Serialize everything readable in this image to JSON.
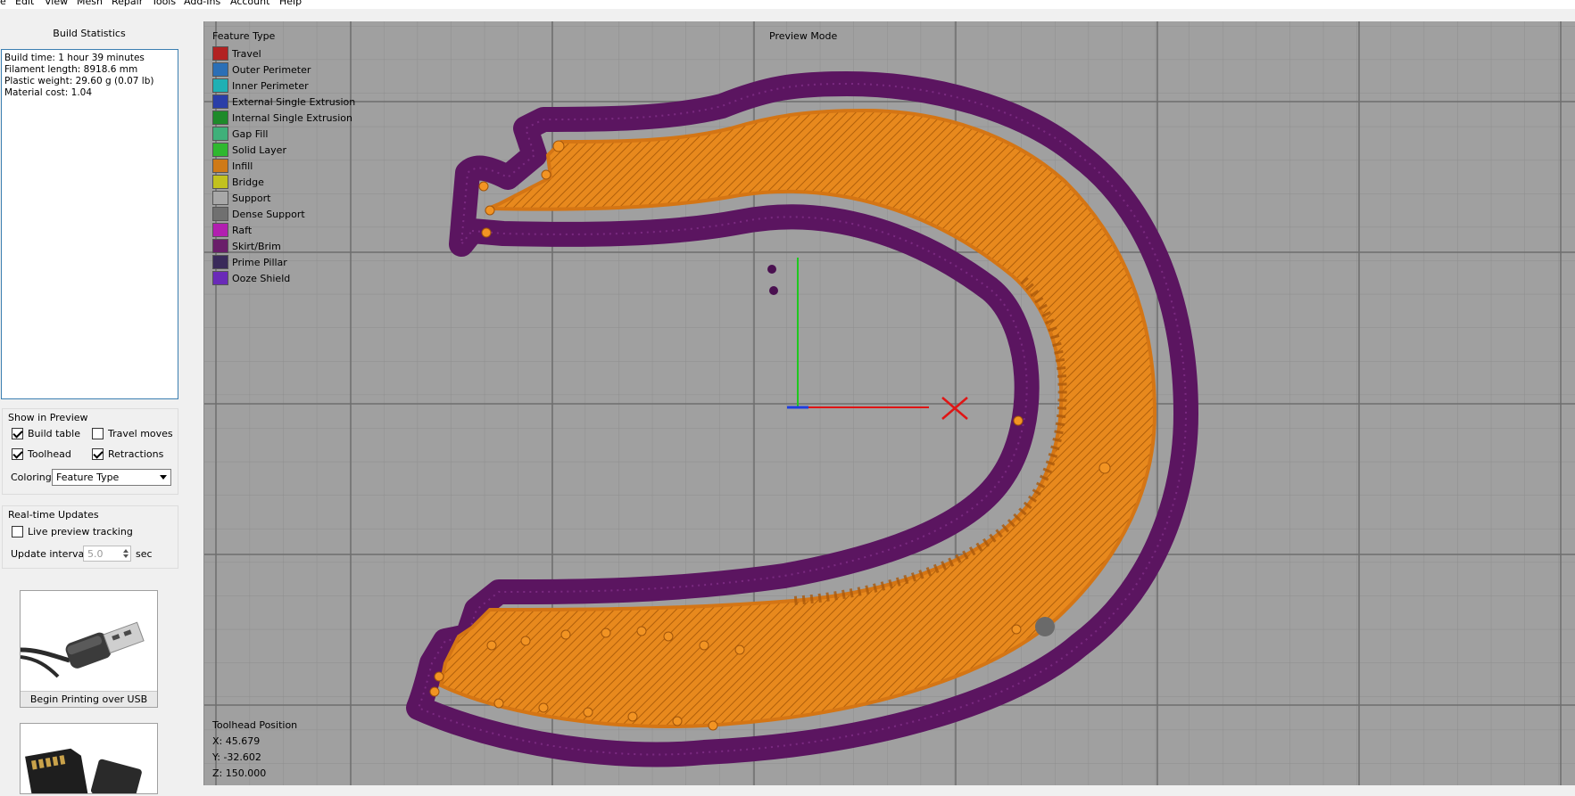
{
  "menu": [
    "Edit",
    "View",
    "Mesh",
    "Repair",
    "Tools",
    "Add-Ins",
    "Account",
    "Help"
  ],
  "build_stats": {
    "title": "Build Statistics",
    "lines": [
      "Build time: 1 hour 39 minutes",
      "Filament length: 8918.6 mm",
      "Plastic weight: 29.60 g (0.07 lb)",
      "Material cost: 1.04"
    ]
  },
  "show_in_preview": {
    "title": "Show in Preview",
    "build_table": {
      "label": "Build table",
      "checked": true
    },
    "travel_moves": {
      "label": "Travel moves",
      "checked": false
    },
    "toolhead": {
      "label": "Toolhead",
      "checked": true
    },
    "retractions": {
      "label": "Retractions",
      "checked": true
    },
    "coloring_label": "Coloring",
    "coloring_value": "Feature Type"
  },
  "realtime": {
    "title": "Real-time Updates",
    "live_preview": {
      "label": "Live preview tracking",
      "checked": false
    },
    "update_interval_label": "Update interval",
    "update_interval_value": "5.0",
    "update_interval_unit": "sec"
  },
  "cards": {
    "usb_label": "Begin Printing over USB"
  },
  "viewport": {
    "mode": "Preview Mode",
    "legend_title": "Feature Type",
    "legend": [
      {
        "label": "Travel",
        "color": "#b22222"
      },
      {
        "label": "Outer Perimeter",
        "color": "#2b6fb6"
      },
      {
        "label": "Inner Perimeter",
        "color": "#1fb0b4"
      },
      {
        "label": "External Single Extrusion",
        "color": "#2a3ea8"
      },
      {
        "label": "Internal Single Extrusion",
        "color": "#1e8a2a"
      },
      {
        "label": "Gap Fill",
        "color": "#3fb07a"
      },
      {
        "label": "Solid Layer",
        "color": "#2fb82f"
      },
      {
        "label": "Infill",
        "color": "#cf7a17"
      },
      {
        "label": "Bridge",
        "color": "#c2c21e"
      },
      {
        "label": "Support",
        "color": "#a8a8a8"
      },
      {
        "label": "Dense Support",
        "color": "#707070"
      },
      {
        "label": "Raft",
        "color": "#b21fb0"
      },
      {
        "label": "Skirt/Brim",
        "color": "#6a1e6a"
      },
      {
        "label": "Prime Pillar",
        "color": "#3a2a5a"
      },
      {
        "label": "Ooze Shield",
        "color": "#6a2ab8"
      }
    ],
    "toolhead_title": "Toolhead Position",
    "x": "X: 45.679",
    "y": "Y: -32.602",
    "z": "Z: 150.000"
  }
}
